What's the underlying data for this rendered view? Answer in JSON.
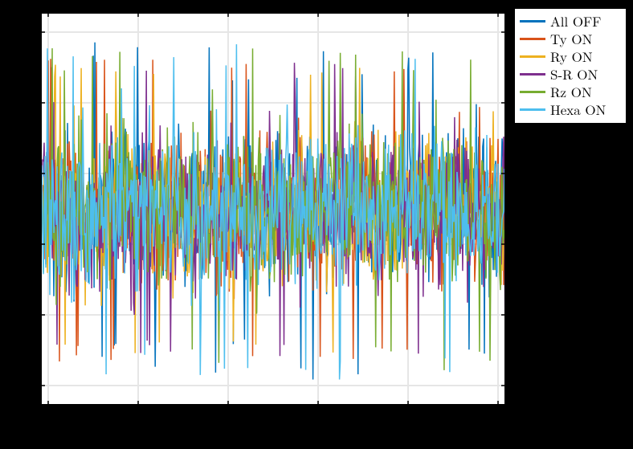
{
  "chart_data": {
    "type": "line",
    "title": "",
    "xlabel": "",
    "ylabel": "",
    "xlim": [
      0,
      500
    ],
    "ylim": [
      -1.2,
      1.2
    ],
    "series": [
      {
        "name": "All OFF",
        "color": "#0072bd",
        "amp": 0.78,
        "spike": 1.05
      },
      {
        "name": "Ty ON",
        "color": "#d95319",
        "amp": 0.82,
        "spike": 0.95
      },
      {
        "name": "Ry ON",
        "color": "#edb120",
        "amp": 0.8,
        "spike": 0.88
      },
      {
        "name": "S-R ON",
        "color": "#7e2f8e",
        "amp": 0.8,
        "spike": 0.9
      },
      {
        "name": "Rz ON",
        "color": "#77ac30",
        "amp": 0.83,
        "spike": 1.0
      },
      {
        "name": "Hexa ON",
        "color": "#4dbeee",
        "amp": 0.85,
        "spike": 1.05
      }
    ],
    "legend_position": "outside-right-top",
    "note": "Dense noise-like time series for each configuration; y-axis ticks hidden, x-axis ticks hidden, grid spacing ~every 20% of width and height."
  }
}
